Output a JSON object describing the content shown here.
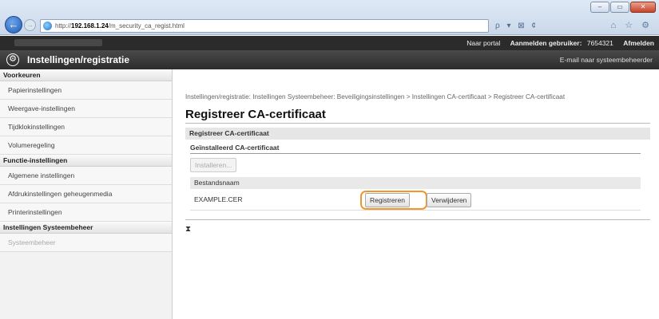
{
  "browser": {
    "url_prefix": "http://",
    "url_host": "192.168.1.24",
    "url_path": "/m_security_ca_regist.html",
    "window_buttons": [
      "‒",
      "▭",
      "✕"
    ],
    "address_tools": "ρ ▾ ⊠ ¢",
    "toolbar_icons": "⌂ ☆ ⚙"
  },
  "topbar": {
    "portal_link": "Naar portal",
    "user_label": "Aanmelden gebruiker:",
    "user_id": "7654321",
    "logout_link": "Afmelden"
  },
  "header": {
    "title": "Instellingen/registratie",
    "email_link": "E-mail naar systeembeheerder"
  },
  "sidebar": {
    "sections": [
      {
        "label": "Voorkeuren",
        "items": [
          {
            "label": "Papierinstellingen",
            "disabled": false
          },
          {
            "label": "Weergave-instellingen",
            "disabled": false
          },
          {
            "label": "Tijdklokinstellingen",
            "disabled": false
          },
          {
            "label": "Volumeregeling",
            "disabled": false
          }
        ]
      },
      {
        "label": "Functie-instellingen",
        "items": [
          {
            "label": "Algemene instellingen",
            "disabled": false
          },
          {
            "label": "Afdrukinstellingen geheugenmedia",
            "disabled": false
          },
          {
            "label": "Printerinstellingen",
            "disabled": false
          }
        ]
      },
      {
        "label": "Instellingen Systeembeheer",
        "items": [
          {
            "label": "Systeembeheer",
            "disabled": true
          }
        ]
      }
    ]
  },
  "main": {
    "breadcrumb": "Instellingen/registratie: Instellingen Systeembeheer: Beveiligingsinstellingen > Instellingen CA-certificaat > Registreer CA-certificaat",
    "page_title": "Registreer CA-certificaat",
    "section_title": "Registreer CA-certificaat",
    "installed_title": "Geïnstalleerd CA-certificaat",
    "install_button": "Installeren...",
    "file_column_header": "Bestandsnaam",
    "file_name": "EXAMPLE.CER",
    "register_button": "Registreren",
    "delete_button": "Verwijderen",
    "top_link": "⧗"
  },
  "colors": {
    "highlight": "#f0962a",
    "header_bg": "#2c2c2c",
    "sidebar_bg": "#f2f2f2"
  }
}
